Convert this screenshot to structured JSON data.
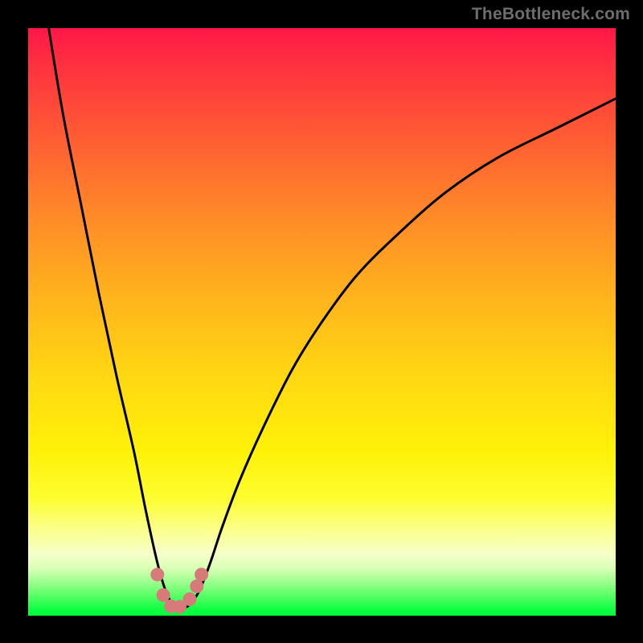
{
  "watermark": "TheBottleneck.com",
  "colors": {
    "page_bg": "#000000",
    "gradient_top": "#ff1747",
    "gradient_bottom": "#00ff3a",
    "curve": "#000000",
    "marker": "#d67b79"
  },
  "chart_data": {
    "type": "line",
    "title": "",
    "xlabel": "",
    "ylabel": "",
    "xlim": [
      0,
      100
    ],
    "ylim": [
      0,
      100
    ],
    "grid": false,
    "legend": false,
    "annotations": [],
    "series": [
      {
        "name": "bottleneck-curve",
        "x": [
          3.5,
          6,
          9,
          12,
          15,
          18,
          20,
          22,
          23.5,
          25,
          27,
          29,
          31,
          33,
          36,
          40,
          45,
          50,
          56,
          63,
          71,
          80,
          90,
          100
        ],
        "y": [
          100,
          85,
          70,
          55,
          41,
          28,
          18,
          9,
          4,
          1.5,
          1.5,
          4,
          9,
          15,
          23,
          32,
          42,
          50,
          58,
          65,
          72,
          78,
          83,
          88
        ]
      }
    ],
    "markers": [
      {
        "x": 22.0,
        "y": 7.0
      },
      {
        "x": 23.0,
        "y": 3.5
      },
      {
        "x": 24.3,
        "y": 1.6
      },
      {
        "x": 25.8,
        "y": 1.5
      },
      {
        "x": 27.5,
        "y": 2.8
      },
      {
        "x": 28.7,
        "y": 5.0
      },
      {
        "x": 29.5,
        "y": 7.0
      }
    ]
  }
}
